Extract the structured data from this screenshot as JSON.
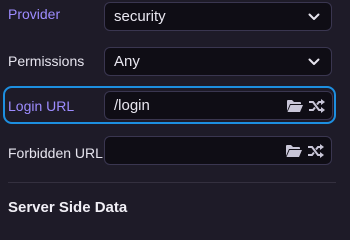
{
  "rows": [
    {
      "label": "Provider",
      "value": "security",
      "control": "select",
      "label_color": "#9d8cff"
    },
    {
      "label": "Permissions",
      "value": "Any",
      "control": "select",
      "label_color": "#e6e4ee"
    },
    {
      "label": "Login URL",
      "value": "/login",
      "control": "path-input",
      "label_color": "#9d8cff",
      "focused": true
    },
    {
      "label": "Forbidden URL",
      "value": "",
      "control": "path-input",
      "label_color": "#e6e4ee"
    }
  ],
  "icons": {
    "select_arrow": "chevron-down-icon",
    "browse": "folder-open-icon",
    "random": "shuffle-icon"
  },
  "section": {
    "title": "Server Side Data"
  },
  "colors": {
    "accent_label": "#9d8cff",
    "focus_border": "#1d8fe0",
    "icon": "#c9c6d8",
    "background": "#1e1b28"
  }
}
